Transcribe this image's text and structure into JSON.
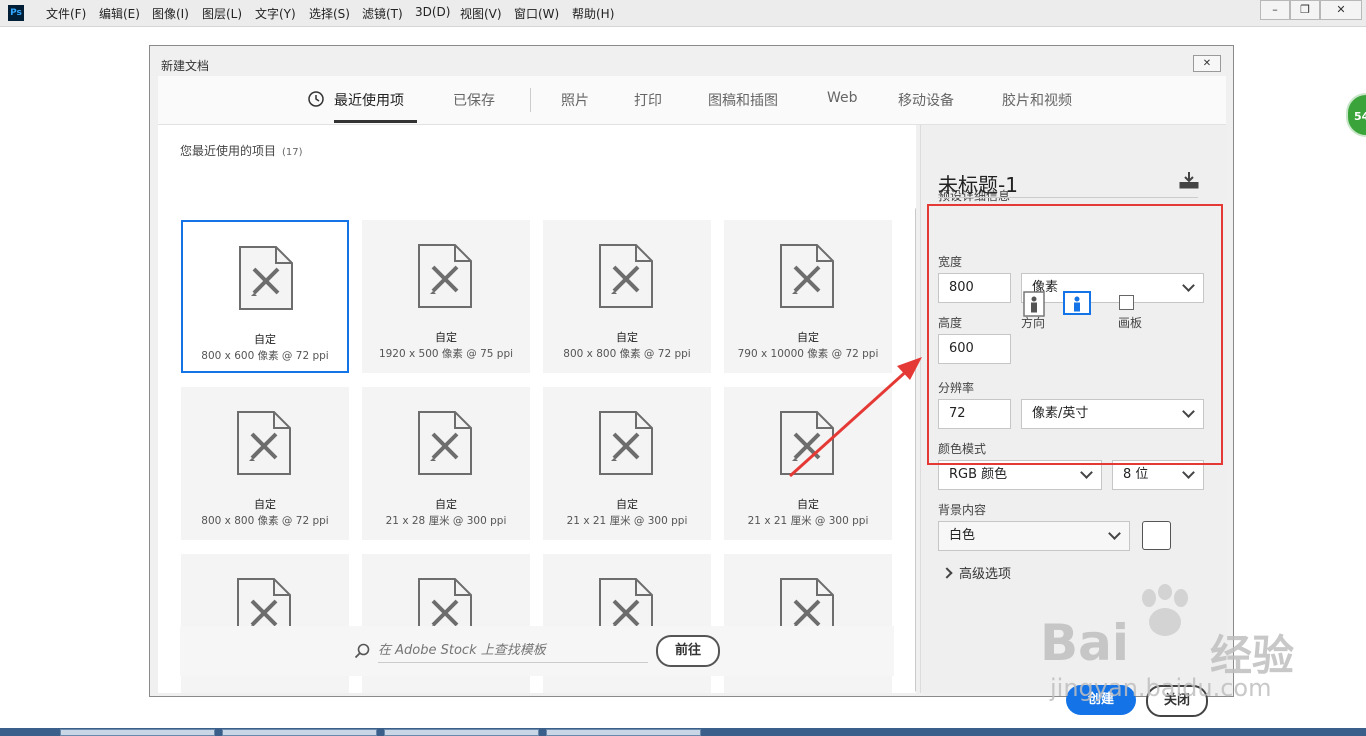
{
  "menubar": {
    "app_icon": "Ps",
    "items": [
      "文件(F)",
      "编辑(E)",
      "图像(I)",
      "图层(L)",
      "文字(Y)",
      "选择(S)",
      "滤镜(T)",
      "3D(D)",
      "视图(V)",
      "窗口(W)",
      "帮助(H)"
    ],
    "window_controls": [
      "–",
      "❐",
      "✕"
    ]
  },
  "dialog": {
    "title": "新建文档",
    "close_glyph": "✕",
    "tabs": [
      "最近使用项",
      "已保存",
      "照片",
      "打印",
      "图稿和插图",
      "Web",
      "移动设备",
      "胶片和视频"
    ],
    "active_tab": 0
  },
  "recent": {
    "title": "您最近使用的项目",
    "count": "(17)",
    "tiles": [
      {
        "name": "自定",
        "dim": "800 x 600 像素 @ 72 ppi"
      },
      {
        "name": "自定",
        "dim": "1920 x 500 像素 @ 75 ppi"
      },
      {
        "name": "自定",
        "dim": "800 x 800 像素 @ 72 ppi"
      },
      {
        "name": "自定",
        "dim": "790 x 10000 像素 @ 72 ppi"
      },
      {
        "name": "自定",
        "dim": "800 x 800 像素 @ 72 ppi"
      },
      {
        "name": "自定",
        "dim": "21 x 28 厘米 @ 300 ppi"
      },
      {
        "name": "自定",
        "dim": "21 x 21 厘米 @ 300 ppi"
      },
      {
        "name": "自定",
        "dim": "21 x 21 厘米 @ 300 ppi"
      },
      {
        "name": "",
        "dim": ""
      },
      {
        "name": "",
        "dim": ""
      },
      {
        "name": "",
        "dim": ""
      },
      {
        "name": "",
        "dim": ""
      }
    ],
    "selected_tile": 0
  },
  "stock": {
    "placeholder": "在 Adobe Stock 上查找模板",
    "go_label": "前往"
  },
  "details": {
    "section_title": "预设详细信息",
    "doc_name": "未标题-1",
    "width_label": "宽度",
    "width_value": "800",
    "width_unit": "像素",
    "height_label": "高度",
    "height_value": "600",
    "orientation_label": "方向",
    "artboard_label": "画板",
    "resolution_label": "分辨率",
    "resolution_value": "72",
    "resolution_unit": "像素/英寸",
    "color_mode_label": "颜色模式",
    "color_mode_value": "RGB 颜色",
    "bit_depth_value": "8 位",
    "background_label": "背景内容",
    "background_value": "白色",
    "background_color": "#ffffff",
    "advanced_label": "高级选项",
    "create_label": "创建",
    "close_label": "关闭"
  },
  "badge": {
    "text": "54"
  },
  "watermark": {
    "brand": "Bai",
    "brand2": "经验",
    "url": "jingyan.baidu.com"
  },
  "colors": {
    "accent": "#1473e6",
    "highlight": "#e53935"
  }
}
